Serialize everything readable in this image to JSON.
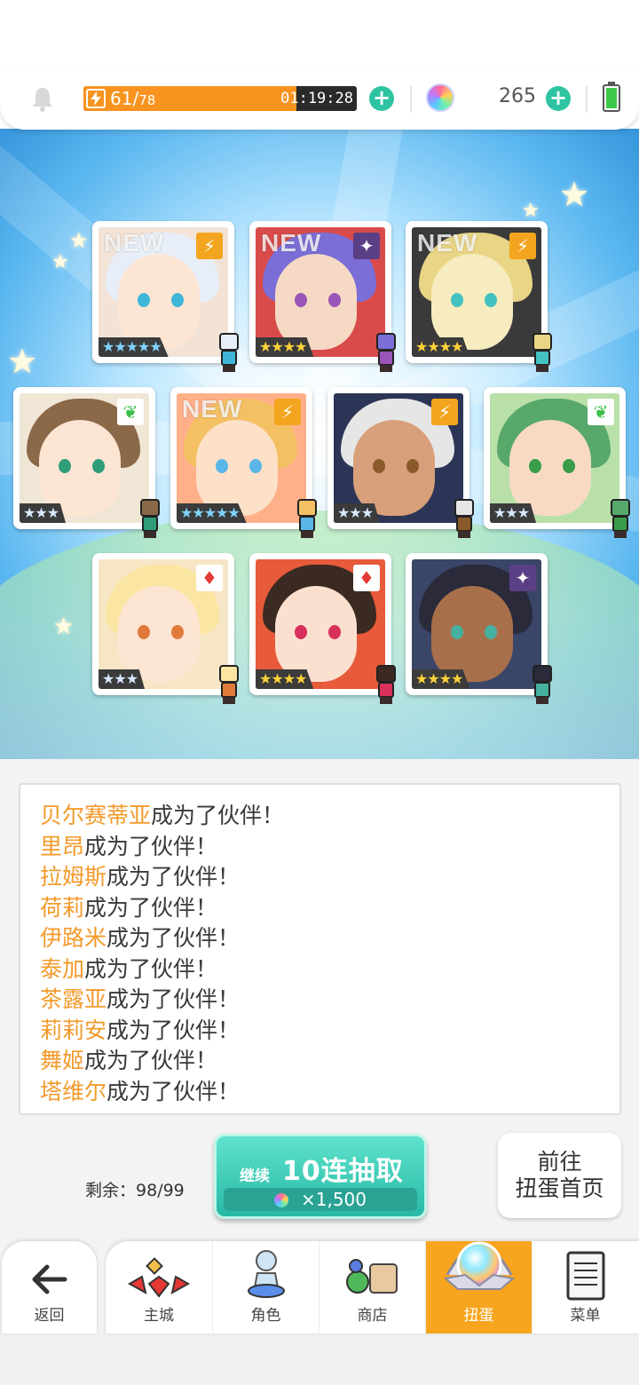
{
  "status": {
    "stamina_current": "61",
    "stamina_max": "78",
    "stamina_fraction": 0.78,
    "timer": "01:19:28",
    "gems": "265"
  },
  "cards": [
    {
      "new": true,
      "element": "thunder",
      "rank": "★★★★★",
      "rank_style": "rainbow"
    },
    {
      "new": true,
      "element": "dark",
      "rank": "★★★★",
      "rank_style": "gold"
    },
    {
      "new": true,
      "element": "thunder",
      "rank": "★★★★",
      "rank_style": "gold"
    },
    {
      "new": false,
      "element": "wind",
      "rank": "★★★",
      "rank_style": "silver"
    },
    {
      "new": true,
      "element": "thunder",
      "rank": "★★★★★",
      "rank_style": "rainbow"
    },
    {
      "new": false,
      "element": "thunder",
      "rank": "★★★",
      "rank_style": "silver"
    },
    {
      "new": false,
      "element": "wind",
      "rank": "★★★",
      "rank_style": "silver"
    },
    {
      "new": false,
      "element": "fire",
      "rank": "★★★",
      "rank_style": "silver"
    },
    {
      "new": false,
      "element": "fire",
      "rank": "★★★★",
      "rank_style": "gold"
    },
    {
      "new": false,
      "element": "dark",
      "rank": "★★★★",
      "rank_style": "gold"
    }
  ],
  "new_label": "NEW",
  "messages": [
    {
      "name": "贝尔赛蒂亚",
      "suffix": "成为了伙伴！"
    },
    {
      "name": "里昂",
      "suffix": "成为了伙伴！"
    },
    {
      "name": "拉姆斯",
      "suffix": "成为了伙伴！"
    },
    {
      "name": "荷莉",
      "suffix": "成为了伙伴！"
    },
    {
      "name": "伊路米",
      "suffix": "成为了伙伴！"
    },
    {
      "name": "泰加",
      "suffix": "成为了伙伴！"
    },
    {
      "name": "茶露亚",
      "suffix": "成为了伙伴！"
    },
    {
      "name": "莉莉安",
      "suffix": "成为了伙伴！"
    },
    {
      "name": "舞姬",
      "suffix": "成为了伙伴！"
    },
    {
      "name": "塔维尔",
      "suffix": "成为了伙伴！"
    }
  ],
  "gacha": {
    "remaining_label": "剩余：",
    "remaining_value": "98/99",
    "continue_label": "继续",
    "pull_label": "10连抽取",
    "cost": "×1,500",
    "goto_line1": "前往",
    "goto_line2": "扭蛋首页"
  },
  "nav": {
    "back": "返回",
    "items": [
      {
        "label": "主城",
        "icon": "castle-icon"
      },
      {
        "label": "角色",
        "icon": "character-icon"
      },
      {
        "label": "商店",
        "icon": "shop-icon"
      },
      {
        "label": "扭蛋",
        "icon": "gacha-icon",
        "active": true
      },
      {
        "label": "菜单",
        "icon": "menu-icon"
      }
    ]
  },
  "colors": {
    "accent_orange": "#f7931e",
    "accent_teal": "#2ec4a2",
    "name_orange": "#f39a2b",
    "nav_active": "#f7a51f"
  }
}
